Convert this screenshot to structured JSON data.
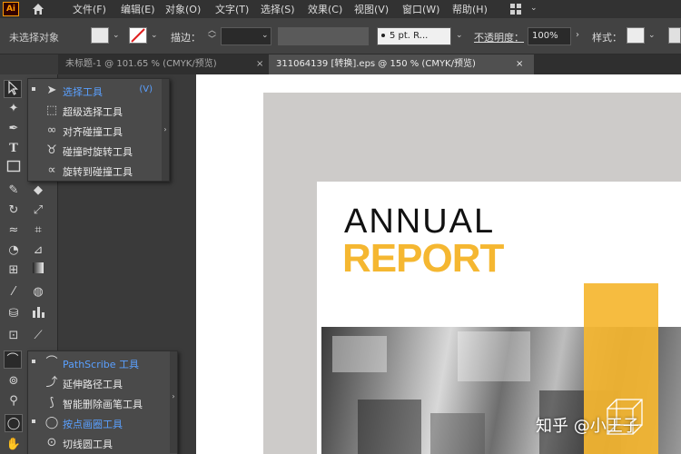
{
  "app": {
    "logo": "Ai"
  },
  "menu": [
    "文件(F)",
    "编辑(E)",
    "对象(O)",
    "文字(T)",
    "选择(S)",
    "效果(C)",
    "视图(V)",
    "窗口(W)",
    "帮助(H)"
  ],
  "control_bar": {
    "selection_status": "未选择对象",
    "stroke_label": "描边：",
    "brush_value": "5 pt. R...",
    "opacity_label": "不透明度：",
    "opacity_value": "100%",
    "style_label": "样式："
  },
  "tabs": [
    {
      "label": "未标题-1 @ 101.65 % (CMYK/预览)",
      "close": "×"
    },
    {
      "label": "311064139 [转换].eps @ 150 % (CMYK/预览)",
      "close": "×"
    }
  ],
  "selection_flyout": [
    {
      "label": "选择工具",
      "key": "(V)",
      "icon": "arrow-icon",
      "selected": true
    },
    {
      "label": "超级选择工具",
      "icon": "marquee-icon"
    },
    {
      "label": "对齐碰撞工具",
      "icon": "circles-icon"
    },
    {
      "label": "碰撞时旋转工具",
      "icon": "rotate-collide-icon"
    },
    {
      "label": "旋转到碰撞工具",
      "icon": "rotate-to-icon"
    }
  ],
  "path_flyout": [
    {
      "label": "PathScribe 工具",
      "icon": "pathscribe-icon",
      "selected": true
    },
    {
      "label": "延伸路径工具",
      "icon": "extend-path-icon"
    },
    {
      "label": "智能删除画笔工具",
      "icon": "smart-delete-icon"
    },
    {
      "label": "按点画圈工具",
      "icon": "circle-by-points-icon",
      "selected": true
    },
    {
      "label": "切线圆工具",
      "icon": "tangent-circle-icon"
    }
  ],
  "artwork": {
    "title_line1": "ANNUAL",
    "title_line2": "REPORT",
    "accent_color": "#f5b731"
  },
  "watermark": {
    "text": "知乎 @小王子"
  }
}
